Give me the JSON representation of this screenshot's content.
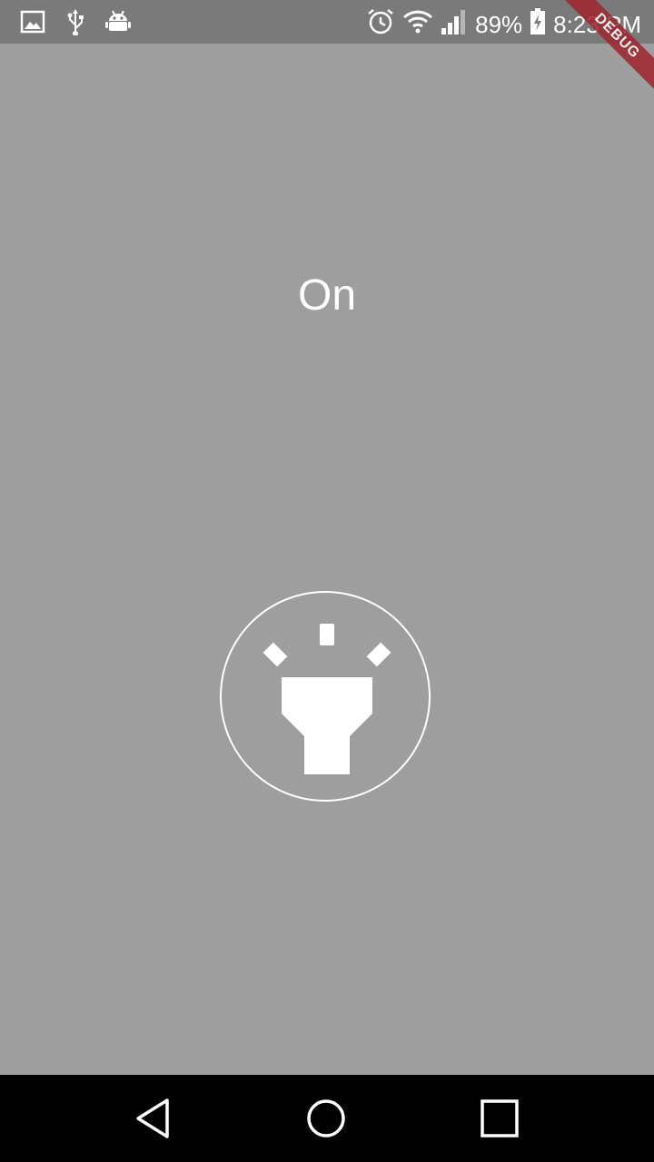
{
  "status_bar": {
    "left_icons": [
      "image-icon",
      "usb-icon",
      "android-icon"
    ],
    "right_icons": [
      "alarm-icon",
      "wifi-icon",
      "signal-icon",
      "battery-charging-icon"
    ],
    "battery_percent": "89%",
    "time": "8:23 PM",
    "debug_banner": "DEBUG"
  },
  "main": {
    "flashlight_state": "On",
    "toggle_icon": "flashlight-icon"
  },
  "nav_bar": {
    "buttons": [
      "back-icon",
      "home-icon",
      "recents-icon"
    ]
  },
  "colors": {
    "background": "#9e9e9e",
    "status_bar": "#7a7a7a",
    "foreground": "#ffffff",
    "nav_bar": "#000000",
    "debug_ribbon": "#a0252f"
  }
}
